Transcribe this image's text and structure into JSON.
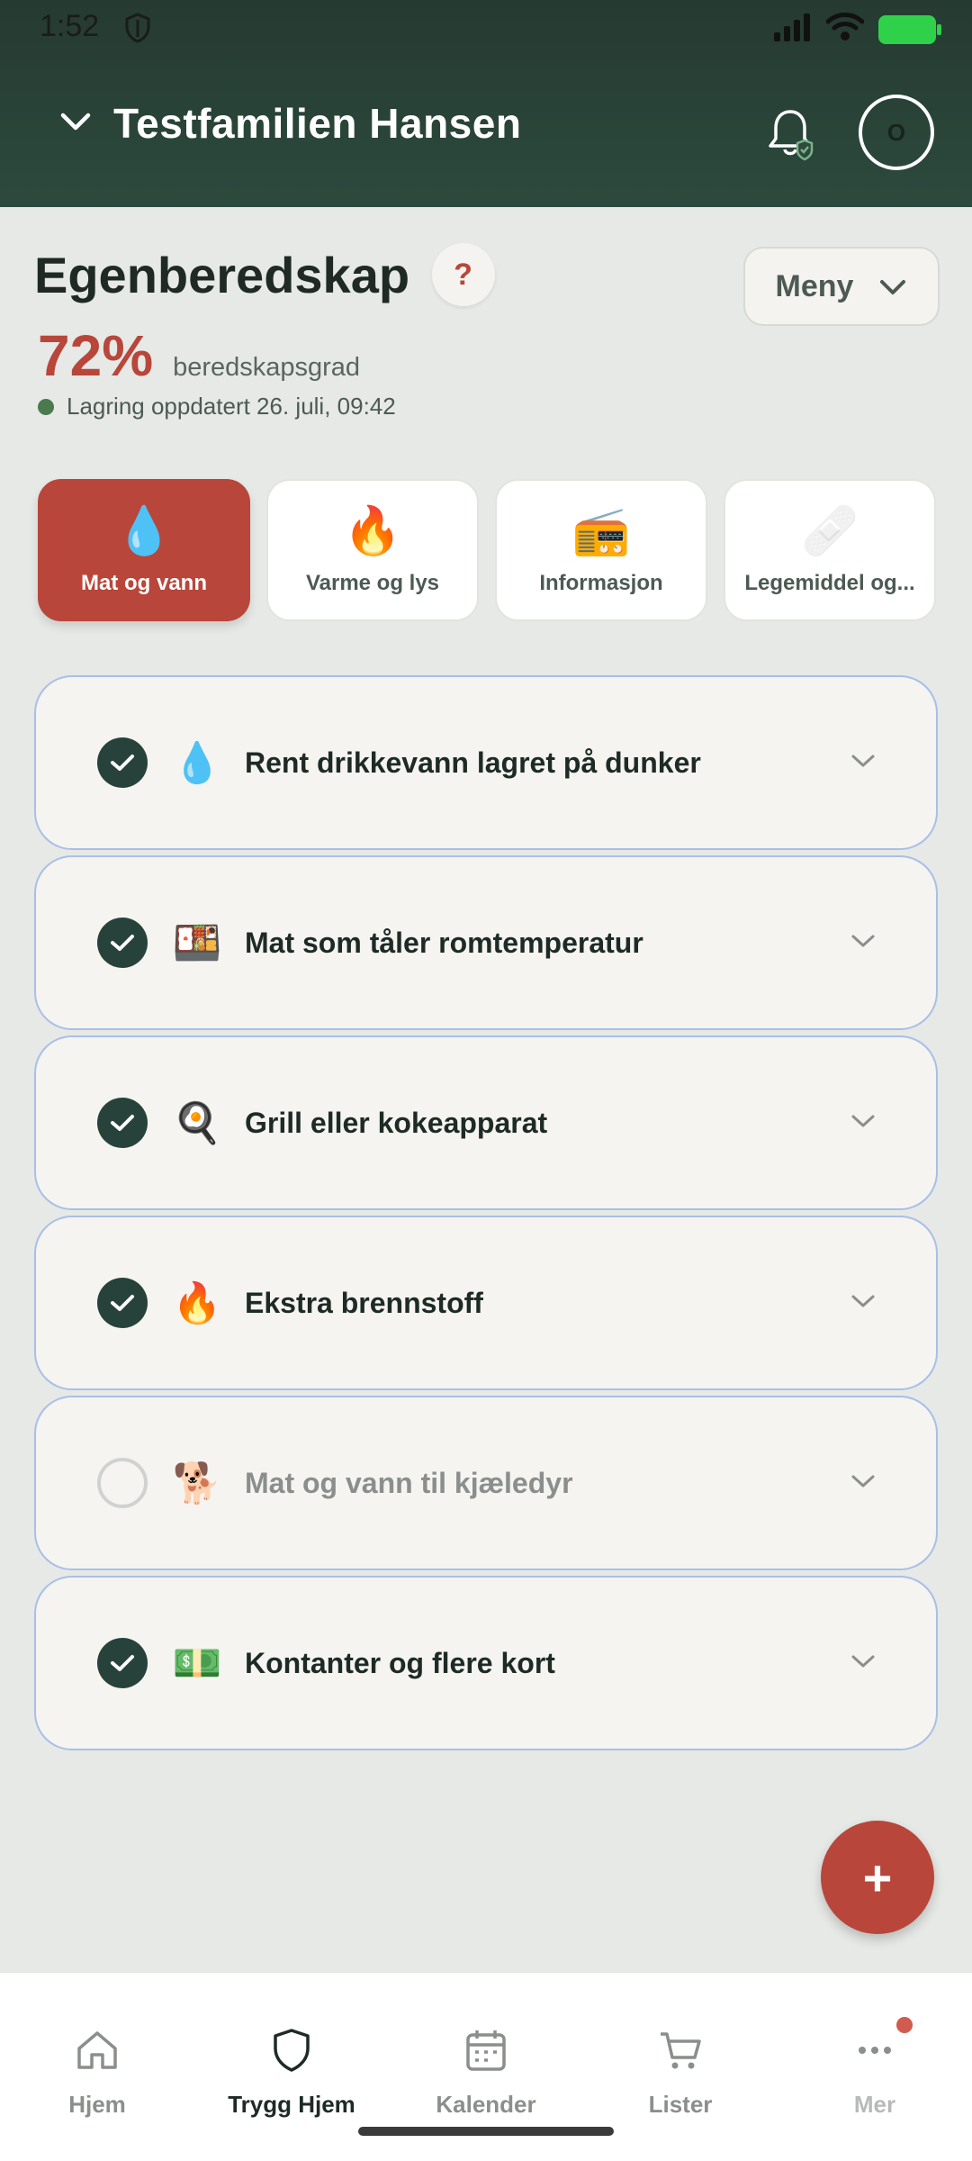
{
  "status_bar": {
    "time": "1:52"
  },
  "header": {
    "family_name": "Testfamilien Hansen",
    "avatar_initial": "O"
  },
  "page": {
    "title": "Egenberedskap",
    "help_label": "?",
    "menu_label": "Meny",
    "score_value": "72%",
    "score_label": "beredskapsgrad",
    "updated_text": "Lagring oppdatert 26. juli, 09:42"
  },
  "tabs": [
    {
      "label": "Mat og vann",
      "icon": "💧",
      "active": true
    },
    {
      "label": "Varme og lys",
      "icon": "🔥",
      "active": false
    },
    {
      "label": "Informasjon",
      "icon": "📻",
      "active": false
    },
    {
      "label": "Legemiddel og...",
      "icon": "🩹",
      "active": false
    }
  ],
  "items": [
    {
      "label": "Rent drikkevann lagret på dunker",
      "icon": "💧",
      "checked": true
    },
    {
      "label": "Mat som tåler romtemperatur",
      "icon": "🍱",
      "checked": true
    },
    {
      "label": "Grill eller kokeapparat",
      "icon": "🍳",
      "checked": true
    },
    {
      "label": "Ekstra brennstoff",
      "icon": "🔥",
      "checked": true
    },
    {
      "label": "Mat og vann til kjæledyr",
      "icon": "🐕",
      "checked": false
    },
    {
      "label": "Kontanter og flere kort",
      "icon": "💵",
      "checked": true
    }
  ],
  "fab": {
    "label": "+"
  },
  "nav": [
    {
      "label": "Hjem",
      "icon": "home-icon",
      "active": false
    },
    {
      "label": "Trygg Hjem",
      "icon": "shield-icon",
      "active": true
    },
    {
      "label": "Kalender",
      "icon": "calendar-icon",
      "active": false
    },
    {
      "label": "Lister",
      "icon": "cart-icon",
      "active": false
    },
    {
      "label": "Mer",
      "icon": "more-icon",
      "active": false
    }
  ],
  "colors": {
    "brand_red": "#b8463a",
    "header_green": "#2c4a3d",
    "check_green": "#27423a",
    "card_border": "#a9bfe6"
  }
}
